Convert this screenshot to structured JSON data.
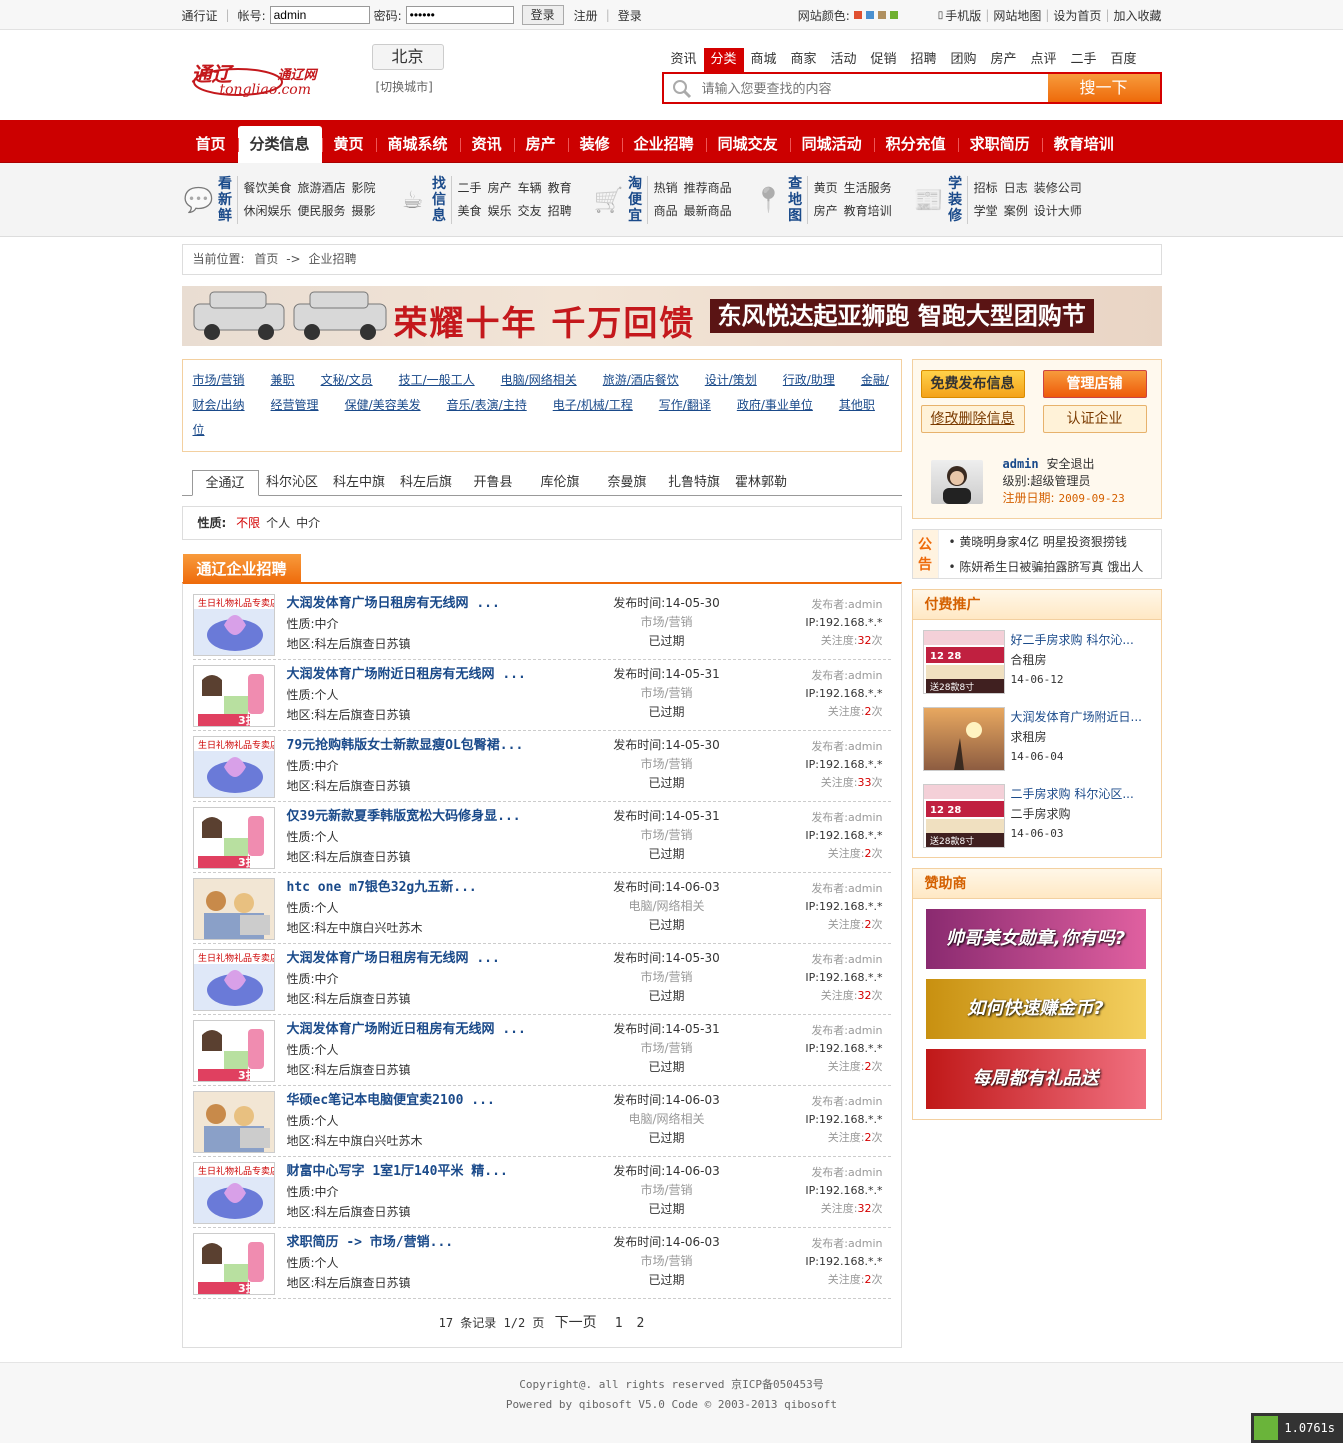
{
  "topbar": {
    "pass_label": "通行证",
    "account_label": "帐号:",
    "account_value": "admin",
    "password_label": "密码:",
    "password_value": "••••••",
    "login_btn": "登录",
    "register": "注册",
    "login_link": "登录",
    "color_label": "网站颜色:",
    "colors": [
      "#e05030",
      "#4a90d0",
      "#b09060",
      "#70b030"
    ],
    "mobile": "手机版",
    "sitemap": "网站地图",
    "set_home": "设为首页",
    "favorite": "加入收藏"
  },
  "header": {
    "logo_cn": "通辽",
    "logo_net": "通辽网",
    "logo_en": "tongliao.com",
    "city": "北京",
    "switch_city": "[切换城市]",
    "search_tabs": [
      "资讯",
      "分类",
      "商城",
      "商家",
      "活动",
      "促销",
      "招聘",
      "团购",
      "房产",
      "点评",
      "二手",
      "百度"
    ],
    "search_placeholder": "请输入您要查找的内容",
    "search_btn": "搜一下"
  },
  "nav": [
    "首页",
    "分类信息",
    "黄页",
    "商城系统",
    "资讯",
    "房产",
    "装修",
    "企业招聘",
    "同城交友",
    "同城活动",
    "积分充值",
    "求职简历",
    "教育培训"
  ],
  "quick": [
    {
      "title": "看新鲜",
      "row1": [
        "餐饮美食",
        "旅游酒店",
        "影院"
      ],
      "row2": [
        "休闲娱乐",
        "便民服务",
        "摄影"
      ]
    },
    {
      "title": "找信息",
      "row1": [
        "二手",
        "房产",
        "车辆",
        "教育"
      ],
      "row2": [
        "美食",
        "娱乐",
        "交友",
        "招聘"
      ]
    },
    {
      "title": "淘便宜",
      "row1": [
        "热销",
        "推荐商品"
      ],
      "row2": [
        "商品",
        "最新商品"
      ]
    },
    {
      "title": "查地图",
      "row1": [
        "黄页",
        "生活服务"
      ],
      "row2": [
        "房产",
        "教育培训"
      ]
    },
    {
      "title": "学装修",
      "row1": [
        "招标",
        "日志",
        "装修公司"
      ],
      "row2": [
        "学堂",
        "案例",
        "设计大师"
      ]
    }
  ],
  "breadcrumb": {
    "label": "当前位置:",
    "home": "首页",
    "sep": "->",
    "current": "企业招聘"
  },
  "banner": {
    "slogan": "荣耀十年  千万回馈",
    "sub": "东风悦达起亚狮跑  智跑大型团购节"
  },
  "categories": [
    "市场/营销",
    "兼职",
    "文秘/文员",
    "技工/一般工人",
    "电脑/网络相关",
    "旅游/酒店餐饮",
    "设计/策划",
    "行政/助理",
    "金融/财会/出纳",
    "经营管理",
    "保健/美容美发",
    "音乐/表演/主持",
    "电子/机械/工程",
    "写作/翻译",
    "政府/事业单位",
    "其他职位"
  ],
  "regions": [
    "全通辽",
    "科尔沁区",
    "科左中旗",
    "科左后旗",
    "开鲁县",
    "库伦旗",
    "奈曼旗",
    "扎鲁特旗",
    "霍林郭勒"
  ],
  "nature": {
    "label": "性质:",
    "options": [
      "不限",
      "个人",
      "中介"
    ]
  },
  "list_title": "通辽企业招聘",
  "listings": [
    {
      "title": "大润发体育广场日租房有无线网 ...",
      "nature": "性质:中介",
      "area": "地区:科左后旗查日苏镇",
      "time": "发布时间:14-05-30",
      "cat": "市场/营销",
      "status": "已过期",
      "poster": "发布者:admin",
      "ip": "IP:192.168.*.*",
      "attn_label": "关注度:",
      "attn": "32",
      "attn_unit": "次",
      "img": "gift"
    },
    {
      "title": "大润发体育广场附近日租房有无线网 ...",
      "nature": "性质:个人",
      "area": "地区:科左后旗查日苏镇",
      "time": "发布时间:14-05-31",
      "cat": "市场/营销",
      "status": "已过期",
      "poster": "发布者:admin",
      "ip": "IP:192.168.*.*",
      "attn_label": "关注度:",
      "attn": "2",
      "attn_unit": "次",
      "img": "cosmetic"
    },
    {
      "title": "79元抢购韩版女士新款显瘦OL包臀裙...",
      "nature": "性质:中介",
      "area": "地区:科左后旗查日苏镇",
      "time": "发布时间:14-05-30",
      "cat": "市场/营销",
      "status": "已过期",
      "poster": "发布者:admin",
      "ip": "IP:192.168.*.*",
      "attn_label": "关注度:",
      "attn": "33",
      "attn_unit": "次",
      "img": "gift"
    },
    {
      "title": "仅39元新款夏季韩版宽松大码修身显...",
      "nature": "性质:个人",
      "area": "地区:科左后旗查日苏镇",
      "time": "发布时间:14-05-31",
      "cat": "市场/营销",
      "status": "已过期",
      "poster": "发布者:admin",
      "ip": "IP:192.168.*.*",
      "attn_label": "关注度:",
      "attn": "2",
      "attn_unit": "次",
      "img": "cosmetic"
    },
    {
      "title": "htc one m7银色32g九五新...",
      "nature": "性质:个人",
      "area": "地区:科左中旗白兴吐苏木",
      "time": "发布时间:14-06-03",
      "cat": "电脑/网络相关",
      "status": "已过期",
      "poster": "发布者:admin",
      "ip": "IP:192.168.*.*",
      "attn_label": "关注度:",
      "attn": "2",
      "attn_unit": "次",
      "img": "kids"
    },
    {
      "title": "大润发体育广场日租房有无线网 ...",
      "nature": "性质:中介",
      "area": "地区:科左后旗查日苏镇",
      "time": "发布时间:14-05-30",
      "cat": "市场/营销",
      "status": "已过期",
      "poster": "发布者:admin",
      "ip": "IP:192.168.*.*",
      "attn_label": "关注度:",
      "attn": "32",
      "attn_unit": "次",
      "img": "gift"
    },
    {
      "title": "大润发体育广场附近日租房有无线网 ...",
      "nature": "性质:个人",
      "area": "地区:科左后旗查日苏镇",
      "time": "发布时间:14-05-31",
      "cat": "市场/营销",
      "status": "已过期",
      "poster": "发布者:admin",
      "ip": "IP:192.168.*.*",
      "attn_label": "关注度:",
      "attn": "2",
      "attn_unit": "次",
      "img": "cosmetic"
    },
    {
      "title": "华硕ec笔记本电脑便宜卖2100 ...",
      "nature": "性质:个人",
      "area": "地区:科左中旗白兴吐苏木",
      "time": "发布时间:14-06-03",
      "cat": "电脑/网络相关",
      "status": "已过期",
      "poster": "发布者:admin",
      "ip": "IP:192.168.*.*",
      "attn_label": "关注度:",
      "attn": "2",
      "attn_unit": "次",
      "img": "kids"
    },
    {
      "title": "财富中心写字 1室1厅140平米 精...",
      "nature": "性质:中介",
      "area": "地区:科左后旗查日苏镇",
      "time": "发布时间:14-06-03",
      "cat": "市场/营销",
      "status": "已过期",
      "poster": "发布者:admin",
      "ip": "IP:192.168.*.*",
      "attn_label": "关注度:",
      "attn": "32",
      "attn_unit": "次",
      "img": "gift"
    },
    {
      "title": "求职简历 -> 市场/营销...",
      "nature": "性质:个人",
      "area": "地区:科左后旗查日苏镇",
      "time": "发布时间:14-06-03",
      "cat": "市场/营销",
      "status": "已过期",
      "poster": "发布者:admin",
      "ip": "IP:192.168.*.*",
      "attn_label": "关注度:",
      "attn": "2",
      "attn_unit": "次",
      "img": "cosmetic"
    }
  ],
  "pager": {
    "summary": "17 条记录 1/2 页",
    "next": "下一页",
    "pages": [
      "1",
      "2"
    ]
  },
  "user": {
    "publish_btn": "免费发布信息",
    "manage_btn": "管理店铺",
    "edit_btn": "修改删除信息",
    "verify_btn": "认证企业",
    "name": "admin",
    "logout": "安全退出",
    "level": "级别:超级管理员",
    "reg_label": "注册日期:",
    "reg_date": "2009-09-23"
  },
  "notice": {
    "title": "公告",
    "items": [
      "黄晓明身家4亿 明星投资狠捞钱",
      "陈妍希生日被骗拍露脐写真 饿出人"
    ]
  },
  "paid": {
    "title": "付费推广",
    "items": [
      {
        "title": "好二手房求购 科尔沁...",
        "type": "合租房",
        "date": "14-06-12",
        "img": "cake"
      },
      {
        "title": "大润发体育广场附近日...",
        "type": "求租房",
        "date": "14-06-04",
        "img": "sunset"
      },
      {
        "title": "二手房求购 科尔沁区...",
        "type": "二手房求购",
        "date": "14-06-03",
        "img": "cake"
      }
    ]
  },
  "sponsor": {
    "title": "赞助商",
    "banners": [
      "帅哥美女勋章,你有吗?",
      "如何快速赚金币?",
      "每周都有礼品送"
    ]
  },
  "footer": {
    "line1": "Copyright@. all rights reserved 京ICP备050453号",
    "line2": "Powered by qibosoft V5.0 Code © 2003-2013 qibosoft"
  },
  "timer": "1.0761s"
}
